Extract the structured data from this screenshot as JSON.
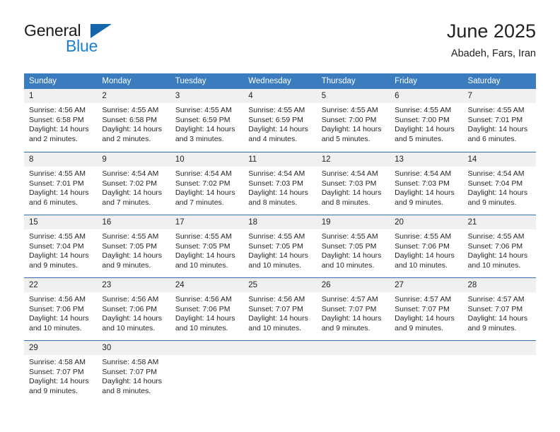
{
  "brand": {
    "word1": "General",
    "word2": "Blue",
    "flag_icon": "triangle-flag-icon",
    "accent_dark": "#1565ad",
    "accent_light": "#1b7fd4"
  },
  "header": {
    "title": "June 2025",
    "location": "Abadeh, Fars, Iran"
  },
  "colors": {
    "header_band": "#3a7cbe",
    "day_band": "#f0f0f0",
    "row_divider": "#2f6fb0",
    "text": "#262626"
  },
  "calendar": {
    "weekday_headers": [
      "Sunday",
      "Monday",
      "Tuesday",
      "Wednesday",
      "Thursday",
      "Friday",
      "Saturday"
    ],
    "weeks": [
      [
        {
          "day": "1",
          "sunrise": "Sunrise: 4:56 AM",
          "sunset": "Sunset: 6:58 PM",
          "daylight1": "Daylight: 14 hours",
          "daylight2": "and 2 minutes."
        },
        {
          "day": "2",
          "sunrise": "Sunrise: 4:55 AM",
          "sunset": "Sunset: 6:58 PM",
          "daylight1": "Daylight: 14 hours",
          "daylight2": "and 2 minutes."
        },
        {
          "day": "3",
          "sunrise": "Sunrise: 4:55 AM",
          "sunset": "Sunset: 6:59 PM",
          "daylight1": "Daylight: 14 hours",
          "daylight2": "and 3 minutes."
        },
        {
          "day": "4",
          "sunrise": "Sunrise: 4:55 AM",
          "sunset": "Sunset: 6:59 PM",
          "daylight1": "Daylight: 14 hours",
          "daylight2": "and 4 minutes."
        },
        {
          "day": "5",
          "sunrise": "Sunrise: 4:55 AM",
          "sunset": "Sunset: 7:00 PM",
          "daylight1": "Daylight: 14 hours",
          "daylight2": "and 5 minutes."
        },
        {
          "day": "6",
          "sunrise": "Sunrise: 4:55 AM",
          "sunset": "Sunset: 7:00 PM",
          "daylight1": "Daylight: 14 hours",
          "daylight2": "and 5 minutes."
        },
        {
          "day": "7",
          "sunrise": "Sunrise: 4:55 AM",
          "sunset": "Sunset: 7:01 PM",
          "daylight1": "Daylight: 14 hours",
          "daylight2": "and 6 minutes."
        }
      ],
      [
        {
          "day": "8",
          "sunrise": "Sunrise: 4:55 AM",
          "sunset": "Sunset: 7:01 PM",
          "daylight1": "Daylight: 14 hours",
          "daylight2": "and 6 minutes."
        },
        {
          "day": "9",
          "sunrise": "Sunrise: 4:54 AM",
          "sunset": "Sunset: 7:02 PM",
          "daylight1": "Daylight: 14 hours",
          "daylight2": "and 7 minutes."
        },
        {
          "day": "10",
          "sunrise": "Sunrise: 4:54 AM",
          "sunset": "Sunset: 7:02 PM",
          "daylight1": "Daylight: 14 hours",
          "daylight2": "and 7 minutes."
        },
        {
          "day": "11",
          "sunrise": "Sunrise: 4:54 AM",
          "sunset": "Sunset: 7:03 PM",
          "daylight1": "Daylight: 14 hours",
          "daylight2": "and 8 minutes."
        },
        {
          "day": "12",
          "sunrise": "Sunrise: 4:54 AM",
          "sunset": "Sunset: 7:03 PM",
          "daylight1": "Daylight: 14 hours",
          "daylight2": "and 8 minutes."
        },
        {
          "day": "13",
          "sunrise": "Sunrise: 4:54 AM",
          "sunset": "Sunset: 7:03 PM",
          "daylight1": "Daylight: 14 hours",
          "daylight2": "and 9 minutes."
        },
        {
          "day": "14",
          "sunrise": "Sunrise: 4:54 AM",
          "sunset": "Sunset: 7:04 PM",
          "daylight1": "Daylight: 14 hours",
          "daylight2": "and 9 minutes."
        }
      ],
      [
        {
          "day": "15",
          "sunrise": "Sunrise: 4:55 AM",
          "sunset": "Sunset: 7:04 PM",
          "daylight1": "Daylight: 14 hours",
          "daylight2": "and 9 minutes."
        },
        {
          "day": "16",
          "sunrise": "Sunrise: 4:55 AM",
          "sunset": "Sunset: 7:05 PM",
          "daylight1": "Daylight: 14 hours",
          "daylight2": "and 9 minutes."
        },
        {
          "day": "17",
          "sunrise": "Sunrise: 4:55 AM",
          "sunset": "Sunset: 7:05 PM",
          "daylight1": "Daylight: 14 hours",
          "daylight2": "and 10 minutes."
        },
        {
          "day": "18",
          "sunrise": "Sunrise: 4:55 AM",
          "sunset": "Sunset: 7:05 PM",
          "daylight1": "Daylight: 14 hours",
          "daylight2": "and 10 minutes."
        },
        {
          "day": "19",
          "sunrise": "Sunrise: 4:55 AM",
          "sunset": "Sunset: 7:05 PM",
          "daylight1": "Daylight: 14 hours",
          "daylight2": "and 10 minutes."
        },
        {
          "day": "20",
          "sunrise": "Sunrise: 4:55 AM",
          "sunset": "Sunset: 7:06 PM",
          "daylight1": "Daylight: 14 hours",
          "daylight2": "and 10 minutes."
        },
        {
          "day": "21",
          "sunrise": "Sunrise: 4:55 AM",
          "sunset": "Sunset: 7:06 PM",
          "daylight1": "Daylight: 14 hours",
          "daylight2": "and 10 minutes."
        }
      ],
      [
        {
          "day": "22",
          "sunrise": "Sunrise: 4:56 AM",
          "sunset": "Sunset: 7:06 PM",
          "daylight1": "Daylight: 14 hours",
          "daylight2": "and 10 minutes."
        },
        {
          "day": "23",
          "sunrise": "Sunrise: 4:56 AM",
          "sunset": "Sunset: 7:06 PM",
          "daylight1": "Daylight: 14 hours",
          "daylight2": "and 10 minutes."
        },
        {
          "day": "24",
          "sunrise": "Sunrise: 4:56 AM",
          "sunset": "Sunset: 7:06 PM",
          "daylight1": "Daylight: 14 hours",
          "daylight2": "and 10 minutes."
        },
        {
          "day": "25",
          "sunrise": "Sunrise: 4:56 AM",
          "sunset": "Sunset: 7:07 PM",
          "daylight1": "Daylight: 14 hours",
          "daylight2": "and 10 minutes."
        },
        {
          "day": "26",
          "sunrise": "Sunrise: 4:57 AM",
          "sunset": "Sunset: 7:07 PM",
          "daylight1": "Daylight: 14 hours",
          "daylight2": "and 9 minutes."
        },
        {
          "day": "27",
          "sunrise": "Sunrise: 4:57 AM",
          "sunset": "Sunset: 7:07 PM",
          "daylight1": "Daylight: 14 hours",
          "daylight2": "and 9 minutes."
        },
        {
          "day": "28",
          "sunrise": "Sunrise: 4:57 AM",
          "sunset": "Sunset: 7:07 PM",
          "daylight1": "Daylight: 14 hours",
          "daylight2": "and 9 minutes."
        }
      ],
      [
        {
          "day": "29",
          "sunrise": "Sunrise: 4:58 AM",
          "sunset": "Sunset: 7:07 PM",
          "daylight1": "Daylight: 14 hours",
          "daylight2": "and 9 minutes."
        },
        {
          "day": "30",
          "sunrise": "Sunrise: 4:58 AM",
          "sunset": "Sunset: 7:07 PM",
          "daylight1": "Daylight: 14 hours",
          "daylight2": "and 8 minutes."
        },
        {
          "day": "",
          "sunrise": "",
          "sunset": "",
          "daylight1": "",
          "daylight2": ""
        },
        {
          "day": "",
          "sunrise": "",
          "sunset": "",
          "daylight1": "",
          "daylight2": ""
        },
        {
          "day": "",
          "sunrise": "",
          "sunset": "",
          "daylight1": "",
          "daylight2": ""
        },
        {
          "day": "",
          "sunrise": "",
          "sunset": "",
          "daylight1": "",
          "daylight2": ""
        },
        {
          "day": "",
          "sunrise": "",
          "sunset": "",
          "daylight1": "",
          "daylight2": ""
        }
      ]
    ]
  }
}
